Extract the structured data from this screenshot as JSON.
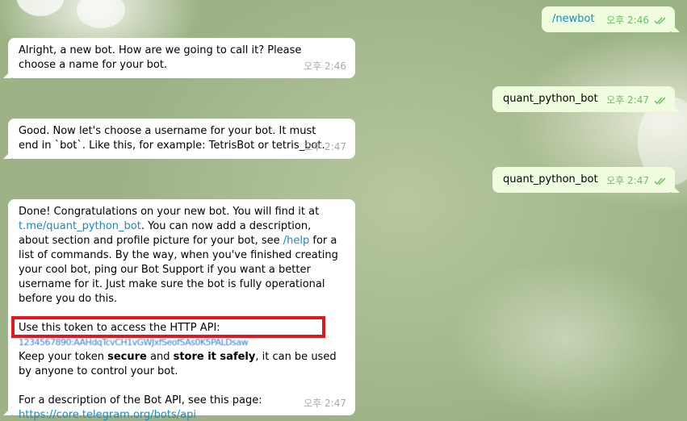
{
  "messages": {
    "out1": {
      "text": "/newbot",
      "time": "오후 2:46"
    },
    "in1": {
      "text": "Alright, a new bot. How are we going to call it? Please choose a name for your bot.",
      "time": "오후 2:46"
    },
    "out2": {
      "text": "quant_python_bot",
      "time": "오후 2:47"
    },
    "in2": {
      "text": "Good. Now let's choose a username for your bot. It must end in `bot`. Like this, for example: TetrisBot or tetris_bot.",
      "time": "오후 2:47"
    },
    "out3": {
      "text": "quant_python_bot",
      "time": "오후 2:47"
    },
    "in3": {
      "p1_a": "Done! Congratulations on your new bot. You will find it at ",
      "p1_link": "t.me/quant_python_bot",
      "p1_b": ". You can now add a description, about section and profile picture for your bot, see ",
      "p1_help": "/help",
      "p1_c": " for a list of commands. By the way, when you've finished creating your cool bot, ping our Bot Support if you want a better username for it. Just make sure the bot is fully operational before you do this.",
      "p2": "Use this token to access the HTTP API:",
      "token": "1234567890:AAHdqTcvCH1vGWJxfSeofSAs0K5PALDsaw",
      "p3_a": "Keep your token ",
      "p3_b1": "secure",
      "p3_and": " and ",
      "p3_b2": "store it safely",
      "p3_c": ", it can be used by anyone to control your bot.",
      "p4": "For a description of the Bot API, see this page:",
      "p4_link": "https://core.telegram.org/bots/api",
      "time": "오후 2:47"
    }
  },
  "colors": {
    "incoming_bubble": "#ffffff",
    "outgoing_bubble": "#effdde",
    "link": "#168acd",
    "read_check": "#6cc264",
    "highlight_box": "#e0191f"
  },
  "icons": {
    "read_receipt": "double-check-icon"
  }
}
